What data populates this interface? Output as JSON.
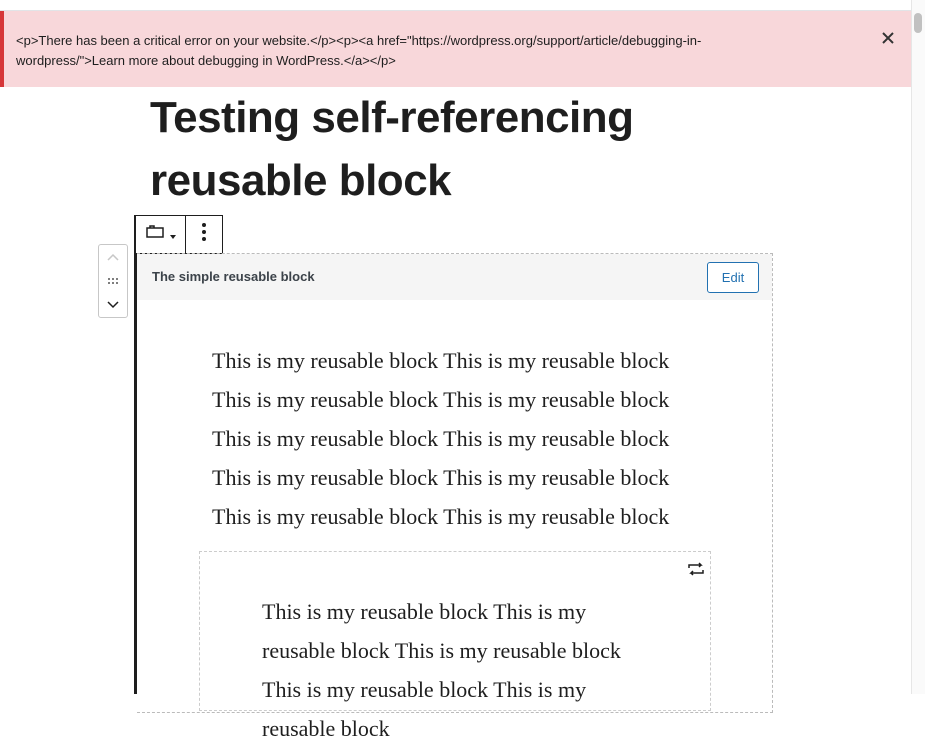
{
  "notice": {
    "text": "<p>There has been a critical error on your website.</p><p><a href=\"https://wordpress.org/support/article/debugging-in-wordpress/\">Learn more about debugging in WordPress.</a></p>",
    "close_icon": "close-icon"
  },
  "post": {
    "title": "Testing self-referencing reusable block"
  },
  "block_toolbar": {
    "switcher_icon": "reusable-block-icon",
    "more_icon": "more-vertical-icon"
  },
  "mover": {
    "up_icon": "chevron-up-icon",
    "drag_icon": "drag-handle-icon",
    "down_icon": "chevron-down-icon"
  },
  "reusable_block": {
    "title": "The simple reusable block",
    "edit_label": "Edit",
    "paragraph": "This is my reusable block This is my reusable block This is my reusable block This is my reusable block This is my reusable block This is my reusable block This is my reusable block This is my reusable block This is my reusable block This is my reusable block",
    "inner_paragraph": "This is my reusable block This is my reusable block This is my reusable block This is my reusable block This is my reusable block",
    "inner_toolbar_icon": "convert-to-regular-icon"
  },
  "colors": {
    "notice_background": "#f8d7da",
    "notice_border": "#d63638",
    "edit_accent": "#2271b1"
  }
}
